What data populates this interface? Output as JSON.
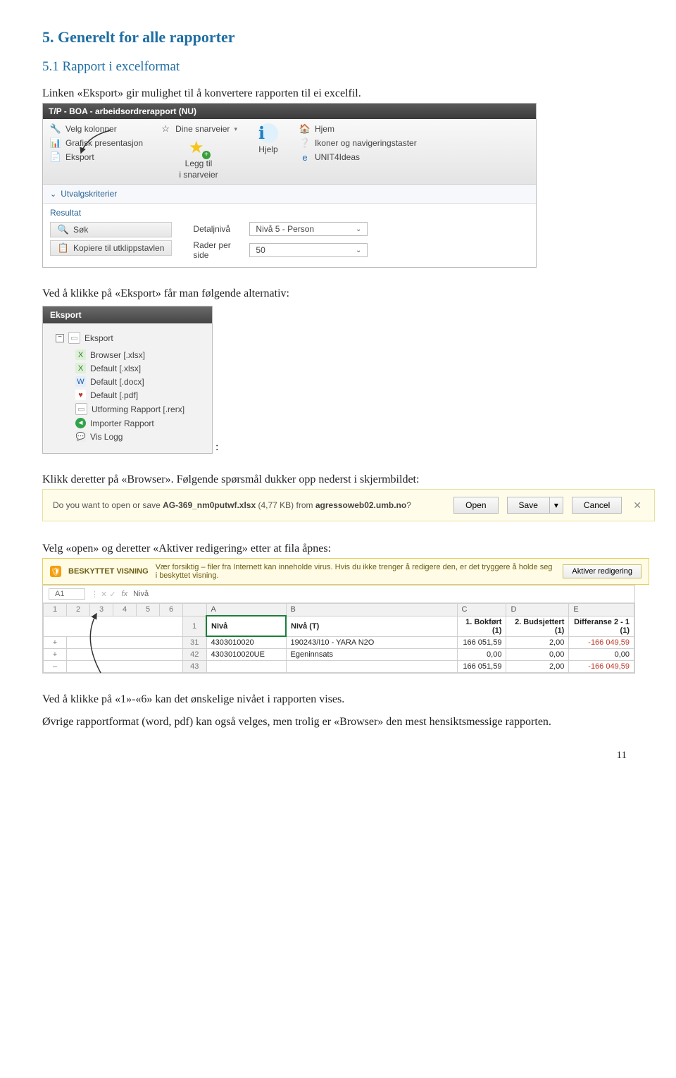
{
  "headings": {
    "h2": "5. Generelt for alle rapporter",
    "h3": "5.1 Rapport i excelformat"
  },
  "paragraphs": {
    "intro": "Linken «Eksport» gir mulighet til å konvertere rapporten til ei excelfil.",
    "alt_intro": "Ved å klikke på «Eksport» får man følgende alternativ:",
    "colon": ":",
    "klikk_browser": "Klikk deretter på «Browser». Følgende spørsmål dukker opp nederst i skjermbildet:",
    "velg_open": "Velg «open» og deretter «Aktiver redigering» etter at fila åpnes:",
    "niva": "Ved å klikke på «1»-«6» kan det ønskelige nivået i rapporten vises.",
    "ovrig": "Øvrige rapportformat (word, pdf) kan også velges, men trolig er «Browser» den mest hensiktsmessige rapporten."
  },
  "shot1": {
    "title": "T/P - BOA - arbeidsordrerapport (NU)",
    "col1": {
      "a": "Velg kolonner",
      "b": "Grafisk presentasjon",
      "c": "Eksport"
    },
    "dine": "Dine snarveier",
    "leggtil": {
      "a": "Legg til",
      "b": "i snarveier"
    },
    "hjelp": "Hjelp",
    "col4": {
      "a": "Hjem",
      "b": "Ikoner og navigeringstaster",
      "c": "UNIT4Ideas"
    },
    "utvalg": "Utvalgskriterier",
    "resultat": "Resultat",
    "sok": "Søk",
    "kopier": "Kopiere til utklippstavlen",
    "detaljniva_lbl": "Detaljnivå",
    "detaljniva_val": "Nivå 5 - Person",
    "rader_lbl_a": "Rader per",
    "rader_lbl_b": "side",
    "rader_val": "50"
  },
  "shot2": {
    "hdr": "Eksport",
    "root": "Eksport",
    "items": {
      "a": "Browser [.xlsx]",
      "b": "Default [.xlsx]",
      "c": "Default [.docx]",
      "d": "Default [.pdf]",
      "e": "Utforming Rapport [.rerx]",
      "f": "Importer Rapport",
      "g": "Vis Logg"
    }
  },
  "shot3": {
    "q": "Do you want to open or save ",
    "file": "AG-369_nm0putwf.xlsx",
    "size": " (4,77 KB) from ",
    "host": "agressoweb02.umb.no",
    "qmark": "?",
    "open": "Open",
    "save": "Save",
    "cancel": "Cancel"
  },
  "shot4": {
    "label": "BESKYTTET VISNING",
    "msg": "Vær forsiktig – filer fra Internett kan inneholde virus. Hvis du ikke trenger å redigere den, er det tryggere å holde seg i beskyttet visning.",
    "btn": "Aktiver redigering"
  },
  "shot5": {
    "cell_ref": "A1",
    "fx_val": "Nivå",
    "cols": {
      "A": "A",
      "B": "B",
      "C": "C",
      "D": "D",
      "E": "E"
    },
    "levels": {
      "l1": "1",
      "l2": "2",
      "l3": "3",
      "l4": "4",
      "l5": "5",
      "l6": "6"
    },
    "outline": {
      "plus": "+",
      "minus": "–"
    },
    "hdr": {
      "r": "1",
      "niva": "Nivå",
      "nivat": "Nivå (T)",
      "c": "1. Bokført (1)",
      "d": "2. Budsjettert (1)",
      "e": "Differanse 2 - 1 (1)"
    },
    "rows": {
      "r1": {
        "rn": "31",
        "a": "4303010020",
        "b": "190243/I10 - YARA N2O",
        "c": "166 051,59",
        "d": "2,00",
        "e": "-166 049,59"
      },
      "r2": {
        "rn": "42",
        "a": "4303010020UE",
        "b": "Egeninnsats",
        "c": "0,00",
        "d": "0,00",
        "e": "0,00"
      },
      "r3": {
        "rn": "43",
        "a": "",
        "b": "",
        "c": "166 051,59",
        "d": "2,00",
        "e": "-166 049,59"
      }
    }
  },
  "page_num": "11"
}
